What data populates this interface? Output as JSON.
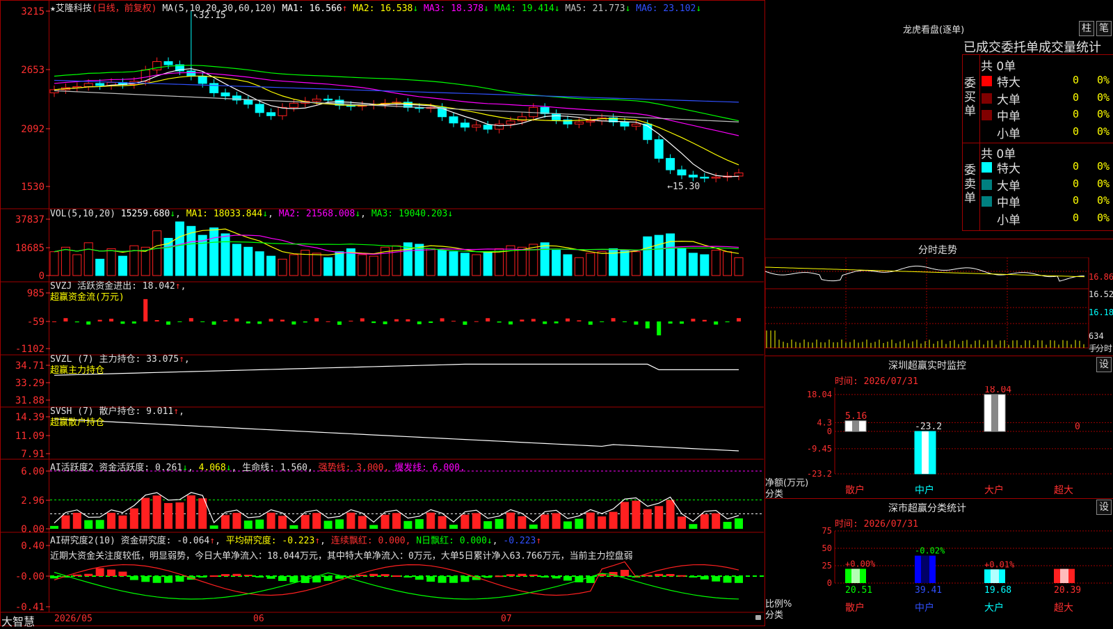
{
  "stock": {
    "title": "★艾隆科技",
    "period": "(日线，前复权)",
    "ma_label": "MA(5,10,20,30,60,120)",
    "ma": [
      {
        "name": "MA1",
        "value": "16.566",
        "arrow": "↑",
        "color": "#ffffff"
      },
      {
        "name": "MA2",
        "value": "16.538",
        "arrow": "↓",
        "color": "#ffff00"
      },
      {
        "name": "MA3",
        "value": "18.378",
        "arrow": "↓",
        "color": "#ff00ff"
      },
      {
        "name": "MA4",
        "value": "19.414",
        "arrow": "↓",
        "color": "#00ff00"
      },
      {
        "name": "MA5",
        "value": "21.773",
        "arrow": "↓",
        "color": "#c0c0c0"
      },
      {
        "name": "MA6",
        "value": "23.102",
        "arrow": "↓",
        "color": "#3050ff"
      }
    ],
    "high_label": "32.15",
    "low_label": "←15.30",
    "price_ticks": [
      "3215",
      "2653",
      "2092",
      "1530"
    ]
  },
  "vol": {
    "label": "VOL(5,10,20)",
    "value": "15259.680",
    "ma1": "MA1: 18033.844",
    "ma2": "MA2: 21568.008",
    "ma3": "MA3: 19040.203",
    "ticks": [
      "37837",
      "18685",
      "0"
    ]
  },
  "svzj": {
    "label": "SVZJ  活跃资金进出: 18.042",
    "arrow": "↑",
    "sub": "超赢资金流(万元)",
    "ticks": [
      "985",
      "-59",
      "-1102"
    ]
  },
  "svzl": {
    "label": "SVZL (7) 主力持仓: 33.075",
    "arrow": "↑",
    "sub": "超赢主力持仓",
    "ticks": [
      "34.71",
      "33.29",
      "31.88"
    ]
  },
  "svsh": {
    "label": "SVSH (7) 散户持仓: 9.011",
    "arrow": "↑",
    "sub": "超赢散户持仓",
    "ticks": [
      "14.39",
      "11.09",
      "7.91"
    ]
  },
  "ai_active": {
    "label": "AI活跃度2 资金活跃度: 0.261",
    "v2": "4.068",
    "life": "生命线: 1.560,",
    "strong": "强势线: 3.000,",
    "burst": "爆发线: 6.000,",
    "ticks": [
      "6.00",
      "2.96",
      "0.00"
    ]
  },
  "ai_research": {
    "label": "AI研究度2(10) 资金研究度: -0.064",
    "avg": "平均研究度: -0.223",
    "red": "连续飘红: 0.000,",
    "nred": "N日飘红: 0.000",
    "last": "-0.223",
    "comment": "近期大资金关注度较低，明显弱势，今日大单净流入：18.044万元，其中特大单净流入：0万元，大单5日累计净入63.766万元，当前主力控盘弱",
    "ticks": [
      "0.40",
      "-0.00",
      "-0.41"
    ]
  },
  "dates": [
    "2026/05",
    "06",
    "07"
  ],
  "brand": "大智慧",
  "lhb": {
    "title": "龙虎看盘(逐单)",
    "btn1": "柱",
    "btn2": "笔",
    "header": "已成交委托单成交量统计",
    "buy_label": "委买单",
    "sell_label": "委卖单",
    "buy_total": "共 0单",
    "sell_total": "共 0单",
    "buy_rows": [
      {
        "name": "特大",
        "count": "0",
        "pct": "0%",
        "color": "#ff0000"
      },
      {
        "name": "大单",
        "count": "0",
        "pct": "0%",
        "color": "#800000"
      },
      {
        "name": "中单",
        "count": "0",
        "pct": "0%",
        "color": "#800000"
      },
      {
        "name": "小单",
        "count": "0",
        "pct": "0%",
        "color": "#000000"
      }
    ],
    "sell_rows": [
      {
        "name": "特大",
        "count": "0",
        "pct": "0%",
        "color": "#00ffff"
      },
      {
        "name": "大单",
        "count": "0",
        "pct": "0%",
        "color": "#008080"
      },
      {
        "name": "中单",
        "count": "0",
        "pct": "0%",
        "color": "#008080"
      },
      {
        "name": "小单",
        "count": "0",
        "pct": "0%",
        "color": "#000000"
      }
    ]
  },
  "intraday": {
    "title": "分时走势",
    "ticks": [
      "16.86",
      "16.52",
      "16.18"
    ],
    "vol_tick": "634",
    "unit": "手",
    "minute": "分时"
  },
  "monitor": {
    "title": "深圳超赢实时监控",
    "btn": "设",
    "time": "时间: 2026/07/31",
    "ticks": [
      "18.04",
      "4.3",
      "0",
      "-9.45",
      "-23.2"
    ],
    "unit": "净额(万元)",
    "axis": "分类",
    "categories": [
      "散户",
      "中户",
      "大户",
      "超大"
    ],
    "values": [
      5.16,
      -23.2,
      18.04,
      0
    ],
    "value_labels": [
      "5.16",
      "-23.2",
      "18.04",
      "0"
    ]
  },
  "classify": {
    "title": "深市超赢分类统计",
    "btn": "设",
    "time": "时间: 2026/07/31",
    "ticks": [
      "75",
      "50",
      "25",
      "0"
    ],
    "unit": "比例%",
    "axis": "分类",
    "categories": [
      "散户",
      "中户",
      "大户",
      "超大"
    ],
    "values": [
      20.51,
      39.41,
      19.68,
      20.39
    ],
    "changes": [
      "+0.00%",
      "-0.02%",
      "+0.01%",
      ""
    ],
    "value_labels": [
      "20.51",
      "39.41",
      "19.68",
      "20.39"
    ]
  }
}
